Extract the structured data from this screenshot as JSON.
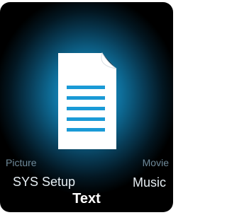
{
  "menu": {
    "selected": "Text",
    "items": {
      "picture": "Picture",
      "movie": "Movie",
      "sys_setup": "SYS Setup",
      "music": "Music",
      "text": "Text"
    }
  },
  "icon": {
    "name": "text-document-icon",
    "glow_color": "#1fa6df",
    "page_color": "#ffffff",
    "line_color": "#1a9ad6"
  }
}
